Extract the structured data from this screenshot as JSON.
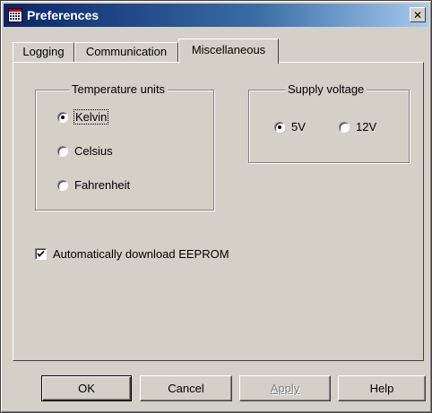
{
  "window": {
    "title": "Preferences",
    "icon": "calendar-grid-icon",
    "close_glyph": "✕"
  },
  "tabs": [
    {
      "label": "Logging",
      "active": false
    },
    {
      "label": "Communication",
      "active": false
    },
    {
      "label": "Miscellaneous",
      "active": true
    }
  ],
  "temperature_units": {
    "label": "Temperature units",
    "options": [
      {
        "label": "Kelvin",
        "checked": true
      },
      {
        "label": "Celsius",
        "checked": false
      },
      {
        "label": "Fahrenheit",
        "checked": false
      }
    ]
  },
  "supply_voltage": {
    "label": "Supply voltage",
    "options": [
      {
        "label": "5V",
        "checked": true
      },
      {
        "label": "12V",
        "checked": false
      }
    ]
  },
  "auto_download": {
    "label": "Automatically download EEPROM",
    "checked": true
  },
  "buttons": {
    "ok": "OK",
    "cancel": "Cancel",
    "apply": "Apply",
    "help": "Help"
  },
  "colors": {
    "title_gradient_start": "#0a246a",
    "title_gradient_end": "#a6caf0",
    "face": "#d4d0c8"
  }
}
